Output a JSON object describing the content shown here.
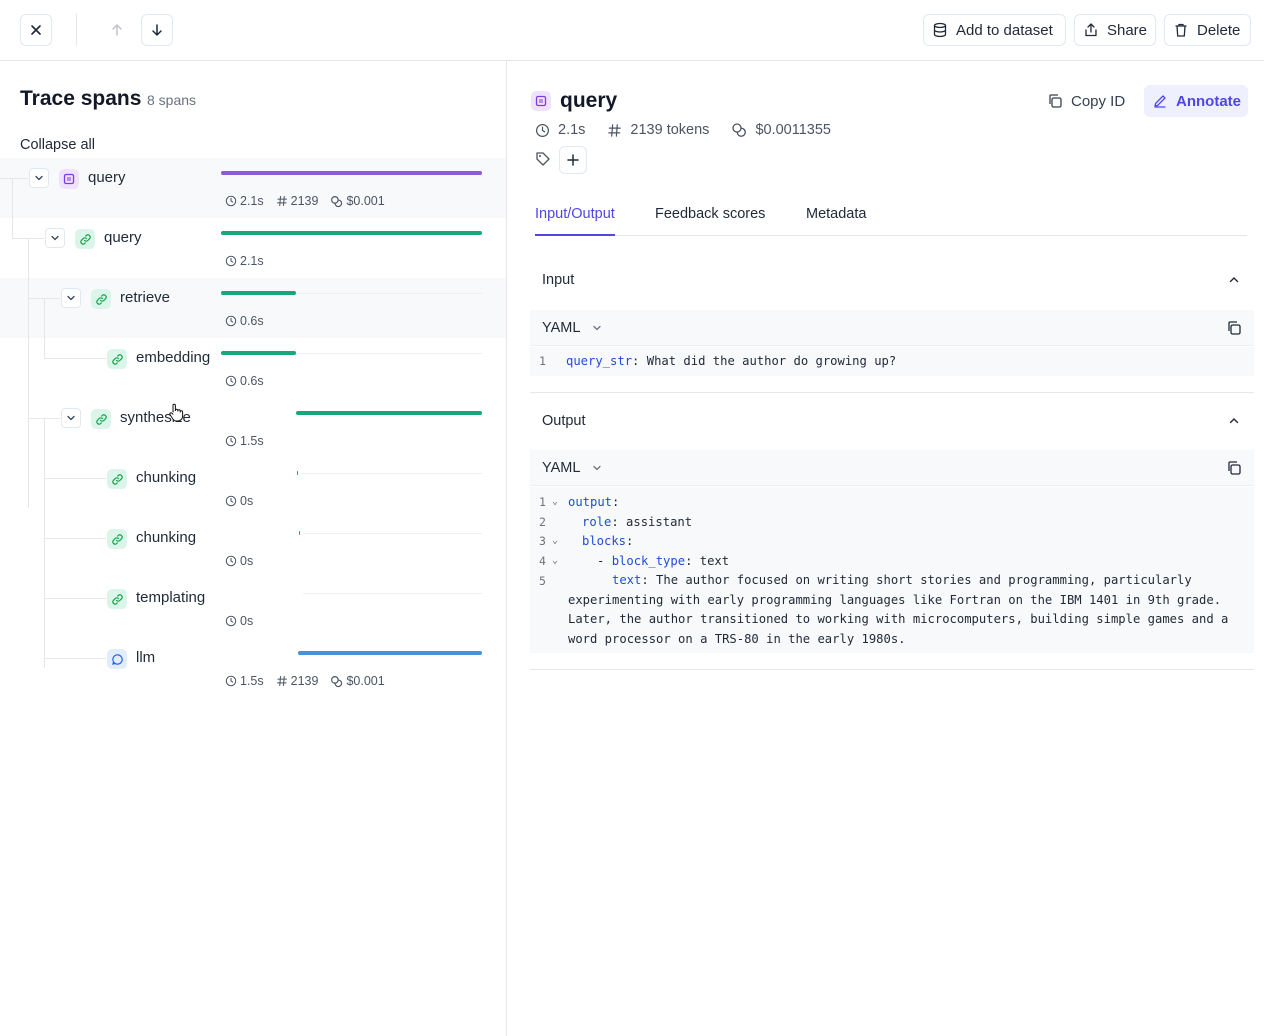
{
  "toolbar": {
    "add_to_dataset": "Add to dataset",
    "share": "Share",
    "delete": "Delete"
  },
  "left": {
    "title": "Trace spans",
    "count": "8 spans",
    "collapse_all": "Collapse all",
    "spans": [
      {
        "name": "query",
        "type": "chain-root",
        "duration": "2.1s",
        "tokens": "2139",
        "cost": "$0.001",
        "bar_start": 0.0,
        "bar_fraction": 1.0,
        "color": "#8b5cd6"
      },
      {
        "name": "query",
        "type": "general",
        "duration": "2.1s",
        "bar_start": 0.0,
        "bar_fraction": 1.0,
        "color": "#16a87a"
      },
      {
        "name": "retrieve",
        "type": "general",
        "duration": "0.6s",
        "bar_start": 0.0,
        "bar_fraction": 0.286,
        "color": "#16a87a"
      },
      {
        "name": "embedding",
        "type": "general",
        "duration": "0.6s",
        "bar_start": 0.0,
        "bar_fraction": 0.286,
        "color": "#16a87a"
      },
      {
        "name": "synthesize",
        "type": "general",
        "duration": "1.5s",
        "bar_start": 0.286,
        "bar_fraction": 0.714,
        "color": "#16a87a"
      },
      {
        "name": "chunking",
        "type": "general",
        "duration": "0s",
        "bar_start": 0.29,
        "bar_fraction": 0.004,
        "color": "#16a87a"
      },
      {
        "name": "chunking",
        "type": "general",
        "duration": "0s",
        "bar_start": 0.298,
        "bar_fraction": 0.004,
        "color": "#16a87a"
      },
      {
        "name": "templating",
        "type": "general",
        "duration": "0s",
        "bar_start": 0.3,
        "bar_fraction": 0.0,
        "color": "#16a87a"
      },
      {
        "name": "llm",
        "type": "llm",
        "duration": "1.5s",
        "tokens": "2139",
        "cost": "$0.001",
        "bar_start": 0.296,
        "bar_fraction": 0.704,
        "color": "#4a90d9"
      }
    ]
  },
  "detail": {
    "title": "query",
    "copy_id": "Copy ID",
    "annotate": "Annotate",
    "duration": "2.1s",
    "tokens": "2139 tokens",
    "cost": "$0.0011355",
    "tabs": [
      "Input/Output",
      "Feedback scores",
      "Metadata"
    ],
    "active_tab": "Input/Output",
    "input": {
      "heading": "Input",
      "format": "YAML",
      "lines": [
        {
          "n": "1",
          "key": "query_str",
          "value": " What did the author do growing up?"
        }
      ]
    },
    "output": {
      "heading": "Output",
      "format": "YAML",
      "lines": [
        {
          "n": "1",
          "key": "output",
          "value": ""
        },
        {
          "n": "2",
          "key": "role",
          "value": " assistant"
        },
        {
          "n": "3",
          "key": "blocks",
          "value": ""
        },
        {
          "n": "4",
          "key": "block_type",
          "value": " text"
        },
        {
          "n": "5",
          "key": "text",
          "value": " The author focused on writing short stories and programming, particularly experimenting with early programming languages like Fortran on the IBM 1401 in 9th grade. Later, the author transitioned to working with microcomputers, building simple games and a word processor on a TRS-80 in the early 1980s."
        }
      ]
    }
  }
}
